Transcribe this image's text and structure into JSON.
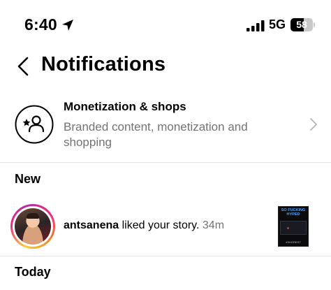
{
  "status_bar": {
    "time": "6:40",
    "network": "5G",
    "battery": "58",
    "battery_level_percent": 58,
    "icons": [
      "location-arrow-icon",
      "signal-icon",
      "battery-icon"
    ]
  },
  "header": {
    "title": "Notifications",
    "back_icon": "chevron-left-icon"
  },
  "monetization": {
    "title": "Monetization & shops",
    "subtitle": "Branded content, monetization and shopping",
    "icon": "person-star-icon",
    "chevron_icon": "chevron-right-icon"
  },
  "sections": {
    "new": "New",
    "today": "Today"
  },
  "notification": {
    "username": "antsanena",
    "action": " liked your story. ",
    "time_ago": "34m",
    "thumbnail": {
      "caption": "SO FUCKING HYPED",
      "tag": "#SHOREST"
    }
  },
  "colors": {
    "text_primary": "#000000",
    "text_secondary": "#737373",
    "divider": "#e6e6e6",
    "background": "#ffffff"
  }
}
